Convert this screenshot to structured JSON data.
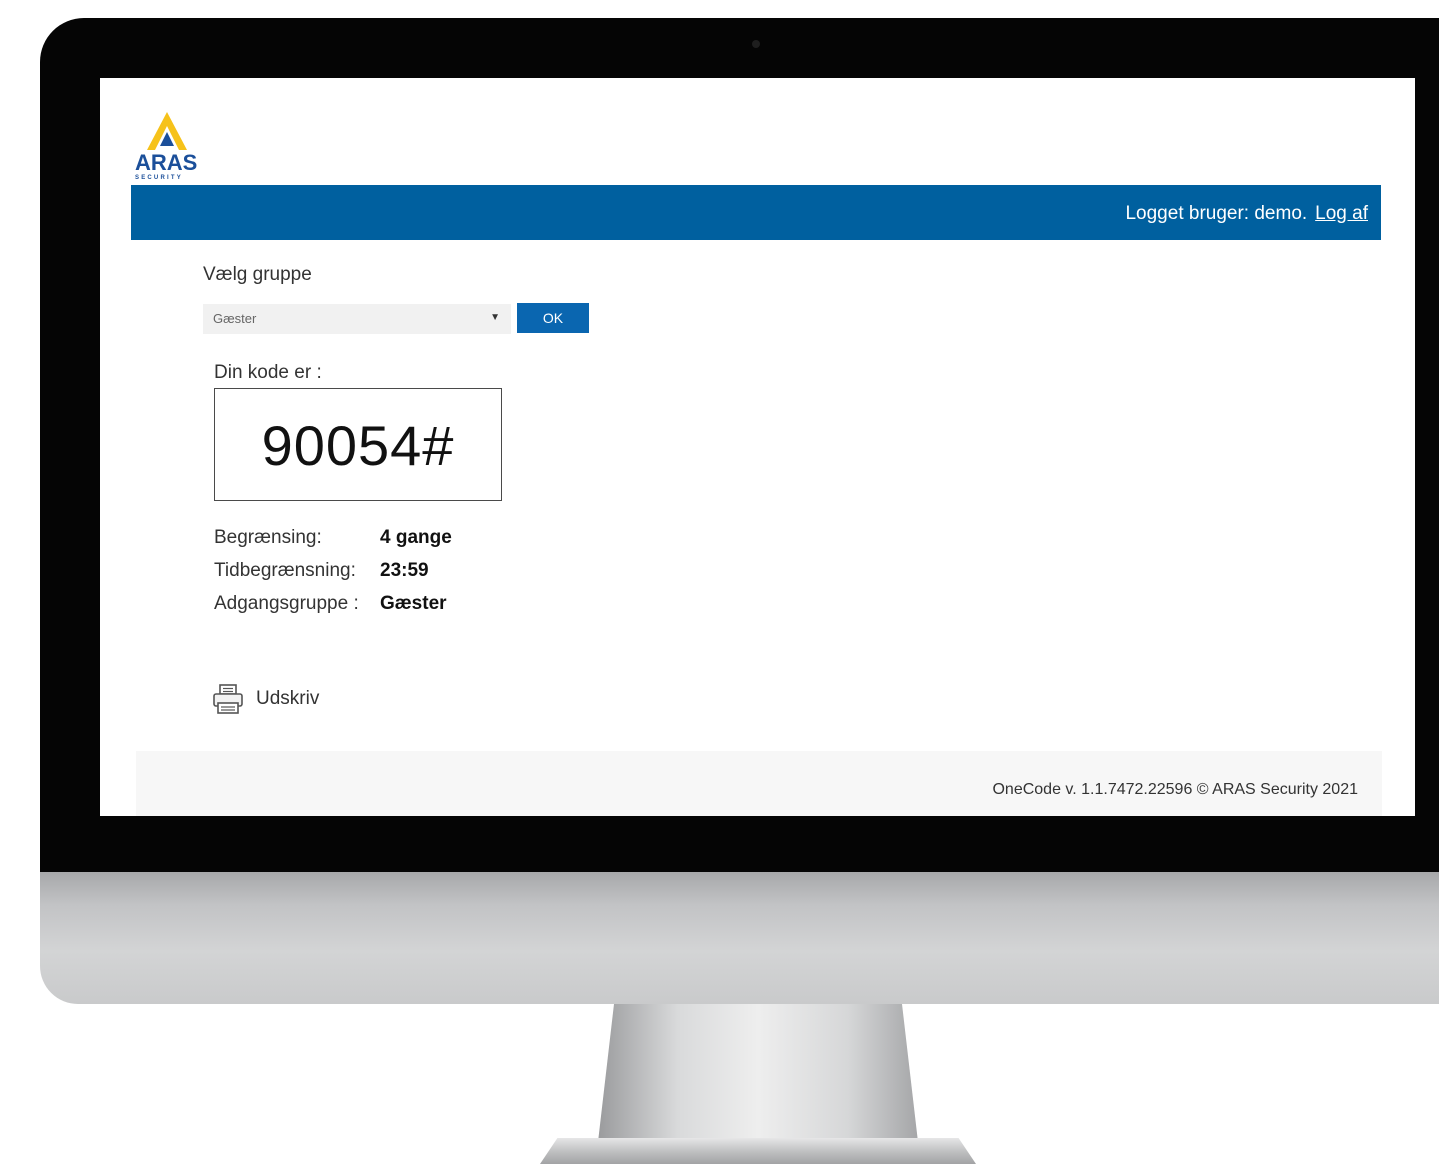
{
  "brand": {
    "name": "ARAS",
    "tagline": "SECURITY",
    "colors": {
      "blue": "#1b4f9a",
      "yellow": "#f6c21a"
    }
  },
  "header": {
    "logged_in_text": "Logget bruger: demo.",
    "logout_label": "Log af",
    "bar_color": "#00609f"
  },
  "group_select": {
    "label": "Vælg gruppe",
    "selected": "Gæster",
    "ok_label": "OK"
  },
  "code": {
    "label": "Din kode er :",
    "value": "90054#"
  },
  "info": [
    {
      "key": "Begrænsing:",
      "value": "4 gange"
    },
    {
      "key": "Tidbegrænsning:",
      "value": "23:59"
    },
    {
      "key": "Adgangsgruppe :",
      "value": "Gæster"
    }
  ],
  "print": {
    "label": "Udskriv",
    "icon": "printer-icon"
  },
  "footer": {
    "text": "OneCode v. 1.1.7472.22596 © ARAS Security 2021"
  }
}
